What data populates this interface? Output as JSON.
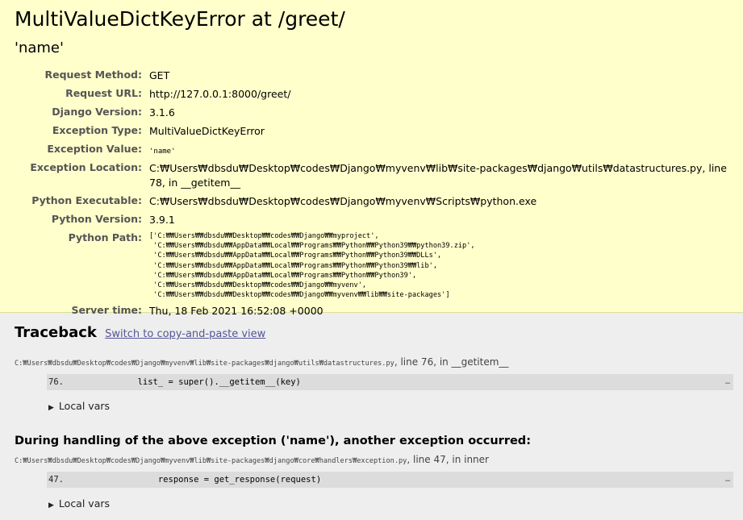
{
  "summary": {
    "title": "MultiValueDictKeyError at /greet/",
    "exception_value_heading": "'name'",
    "rows": [
      {
        "label": "Request Method:",
        "value": "GET"
      },
      {
        "label": "Request URL:",
        "value": "http://127.0.0.1:8000/greet/"
      },
      {
        "label": "Django Version:",
        "value": "3.1.6"
      },
      {
        "label": "Exception Type:",
        "value": "MultiValueDictKeyError"
      },
      {
        "label": "Exception Value:",
        "value": "'name'"
      },
      {
        "label": "Exception Location:",
        "value": "C:₩Users₩dbsdu₩Desktop₩codes₩Django₩myvenv₩lib₩site-packages₩django₩utils₩datastructures.py, line 78, in __getitem__"
      },
      {
        "label": "Python Executable:",
        "value": "C:₩Users₩dbsdu₩Desktop₩codes₩Django₩myvenv₩Scripts₩python.exe"
      },
      {
        "label": "Python Version:",
        "value": "3.9.1"
      },
      {
        "label": "Python Path:",
        "value": "['C:₩₩Users₩₩dbsdu₩₩Desktop₩₩codes₩₩Django₩₩myproject',\n 'C:₩₩Users₩₩dbsdu₩₩AppData₩₩Local₩₩Programs₩₩Python₩₩Python39₩₩python39.zip',\n 'C:₩₩Users₩₩dbsdu₩₩AppData₩₩Local₩₩Programs₩₩Python₩₩Python39₩₩DLLs',\n 'C:₩₩Users₩₩dbsdu₩₩AppData₩₩Local₩₩Programs₩₩Python₩₩Python39₩₩lib',\n 'C:₩₩Users₩₩dbsdu₩₩AppData₩₩Local₩₩Programs₩₩Python₩₩Python39',\n 'C:₩₩Users₩₩dbsdu₩₩Desktop₩₩codes₩₩Django₩₩myvenv',\n 'C:₩₩Users₩₩dbsdu₩₩Desktop₩₩codes₩₩Django₩₩myvenv₩₩lib₩₩site-packages']"
      },
      {
        "label": "Server time:",
        "value": "Thu, 18 Feb 2021 16:52:08 +0000"
      }
    ]
  },
  "traceback": {
    "heading": "Traceback",
    "switch_link": "Switch to copy-and-paste view",
    "frames": [
      {
        "path": "C:₩Users₩dbsdu₩Desktop₩codes₩Django₩myvenv₩lib₩site-packages₩django₩utils₩datastructures.py",
        "location": ", line 76, in __getitem__",
        "lineno": "76.",
        "code": "        list_ = super().__getitem__(key)",
        "dots": "…",
        "local_vars": "Local vars"
      },
      {
        "path": "C:₩Users₩dbsdu₩Desktop₩codes₩Django₩myvenv₩lib₩site-packages₩django₩core₩handlers₩exception.py",
        "location": ", line 47, in inner",
        "lineno": "47.",
        "code": "            response = get_response(request)",
        "dots": "…",
        "local_vars": "Local vars"
      }
    ],
    "during_heading": "During handling of the above exception ('name'), another exception occurred:"
  }
}
